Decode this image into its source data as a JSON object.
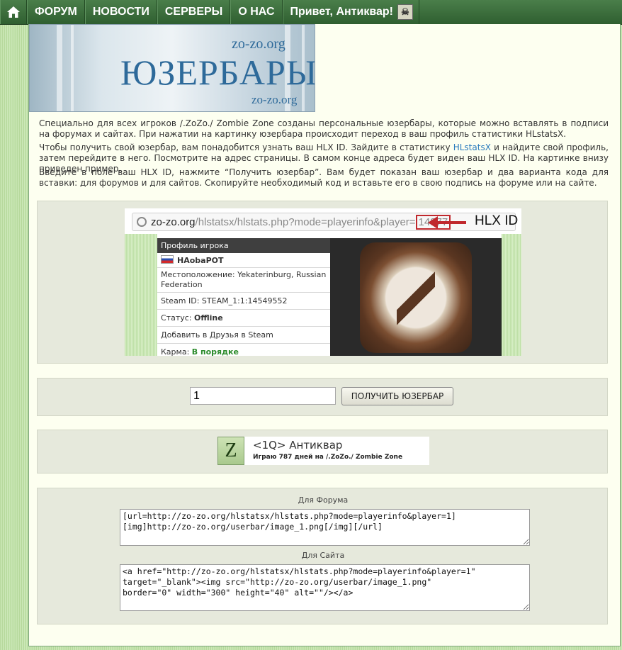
{
  "nav": {
    "items": [
      {
        "label": "ФОРУМ"
      },
      {
        "label": "НОВОСТИ"
      },
      {
        "label": "СЕРВЕРЫ"
      },
      {
        "label": "О НАС"
      }
    ],
    "greeting": "Привет, Антиквар!",
    "home_icon": "home-icon",
    "user_icon": "skull-avatar-icon"
  },
  "banner": {
    "title": "ЮЗЕРБАРЫ",
    "site_top": "zo-zo.org",
    "site_bottom": "zo-zo.org"
  },
  "intro": {
    "p1": "Специально для всех игроков /.ZoZo./ Zombie Zone созданы персональные юзербары, которые можно вставлять в подписи на форумах и сайтах. При нажатии на картинку юзербара происходит переход в ваш профиль статистики HLstatsX.",
    "p2_before": "Чтобы получить свой юзербар, вам понадобится узнать ваш HLX ID. Зайдите в статистику ",
    "p2_link": "HLstatsX",
    "p2_after": " и найдите свой профиль, затем перейдите в него. Посмотрите на адрес страницы. В самом конце адреса будет виден ваш HLX ID. На картинке внизу приведен пример.",
    "p3": "Введите в поле ваш HLX ID, нажмите “Получить юзербар”. Вам будет показан ваш юзербар и два варианта кода для вставки: для форумов и для сайтов. Скопируйте необходимый код и вставьте его в свою подпись на форуме или на сайте."
  },
  "example": {
    "url_domain": "zo-zo.org",
    "url_path": "/hlstatsx/hlstats.php?mode=playerinfo&player=",
    "url_id": "14877",
    "arrow_label": "HLX ID",
    "profile_header": "Профиль игрока",
    "player_name": "HAobaPOT",
    "location": "Местоположение: Yekaterinburg, Russian Federation",
    "steam_id": "Steam ID: STEAM_1:1:14549552",
    "status_label": "Статус: ",
    "status_value": "Offline",
    "add_friend": "Добавить в Друзья в Steam",
    "karma_label": "Карма: ",
    "karma_value": "В порядке"
  },
  "form": {
    "input_value": "1",
    "button_label": "ПОЛУЧИТЬ ЮЗЕРБАР"
  },
  "userbar": {
    "logo_letter": "Z",
    "name": "<1Q> Антиквар",
    "subtitle": "Играю 787 дней на /.ZoZo./ Zombie Zone"
  },
  "codes": {
    "forum_label": "Для Форума",
    "forum_code": "[url=http://zo-zo.org/hlstatsx/hlstats.php?mode=playerinfo&player=1]\n[img]http://zo-zo.org/userbar/image_1.png[/img][/url]",
    "site_label": "Для Сайта",
    "site_code": "<a href=\"http://zo-zo.org/hlstatsx/hlstats.php?mode=playerinfo&player=1\"\ntarget=\"_blank\"><img src=\"http://zo-zo.org/userbar/image_1.png\"\nborder=\"0\" width=\"300\" height=\"40\" alt=\"\"/></a>"
  },
  "colors": {
    "nav_green": "#3d6f3d",
    "accent_red": "#c0282d",
    "link_blue": "#2a7bbd",
    "panel_bg": "#e6e9dc",
    "page_bg": "#fdfff0"
  }
}
